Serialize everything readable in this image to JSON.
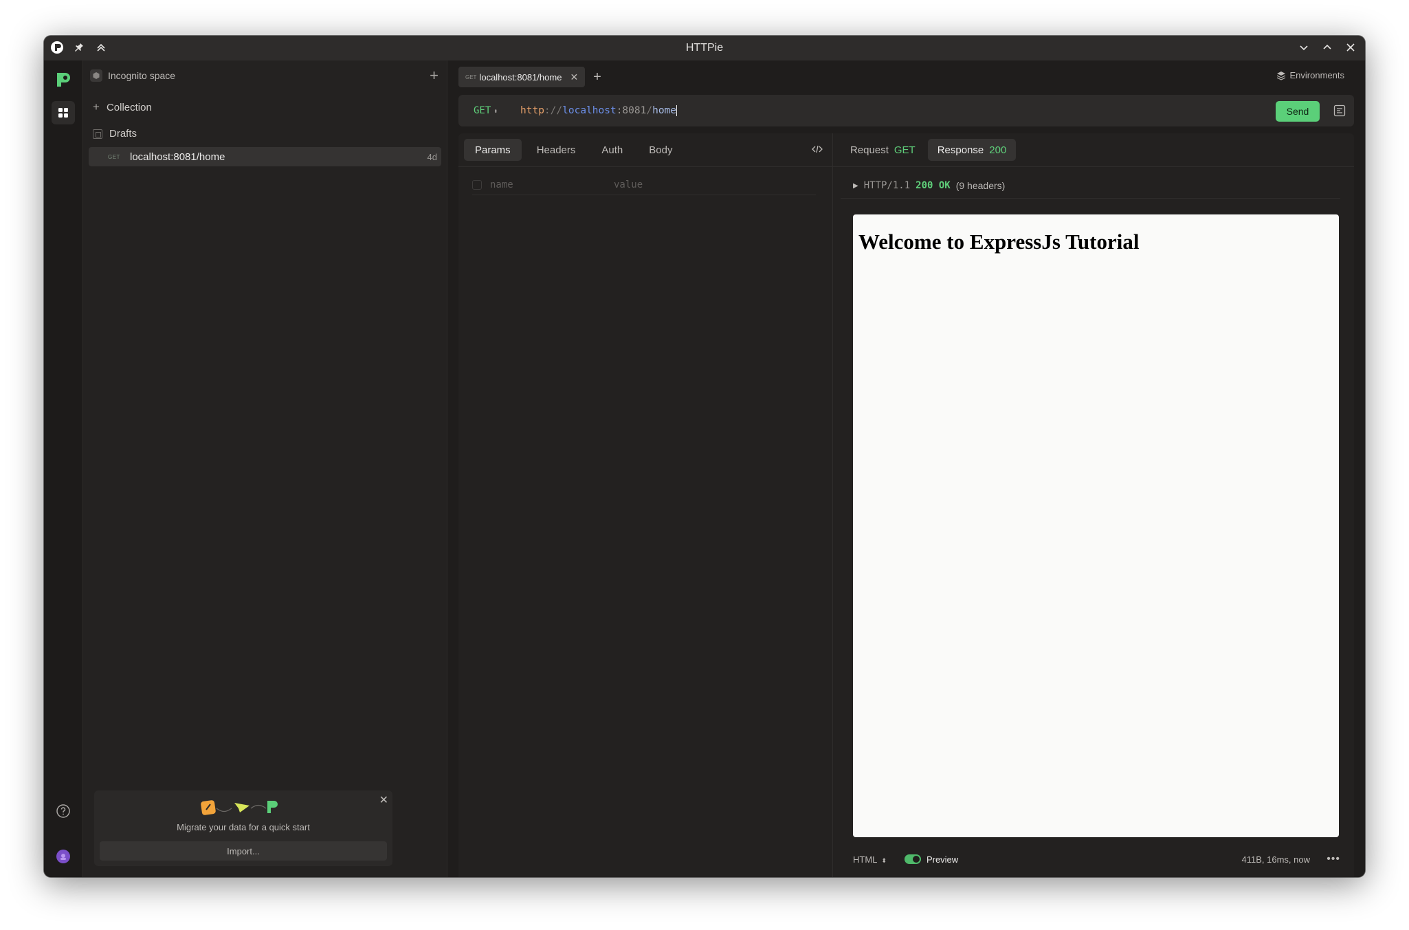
{
  "window": {
    "title": "HTTPie"
  },
  "sidebar": {
    "space_name": "Incognito space",
    "collection_label": "Collection",
    "drafts_label": "Drafts",
    "draft_items": [
      {
        "method": "GET",
        "url": "localhost:8081/home",
        "age": "4d"
      }
    ],
    "migrate": {
      "message": "Migrate your data for a quick start",
      "import_label": "Import..."
    }
  },
  "tabs": [
    {
      "method": "GET",
      "label": "localhost:8081/home"
    }
  ],
  "environments_label": "Environments",
  "request": {
    "method": "GET",
    "url": {
      "scheme": "http",
      "sep": "://",
      "host": "localhost",
      "port": ":8081",
      "slash": "/",
      "path": "home"
    },
    "send_label": "Send",
    "tabs": [
      "Params",
      "Headers",
      "Auth",
      "Body"
    ],
    "params": {
      "name_placeholder": "name",
      "value_placeholder": "value"
    }
  },
  "response": {
    "tab_request": "Request",
    "tab_request_method": "GET",
    "tab_response": "Response",
    "tab_response_status": "200",
    "protocol": "HTTP/1.1",
    "status": "200 OK",
    "headers_count": "(9 headers)",
    "preview_heading": "Welcome to ExpressJs Tutorial",
    "format": "HTML",
    "preview_label": "Preview",
    "stats": "411B, 16ms, now"
  },
  "colors": {
    "accent": "#5bcf79",
    "background": "#201e1d"
  }
}
